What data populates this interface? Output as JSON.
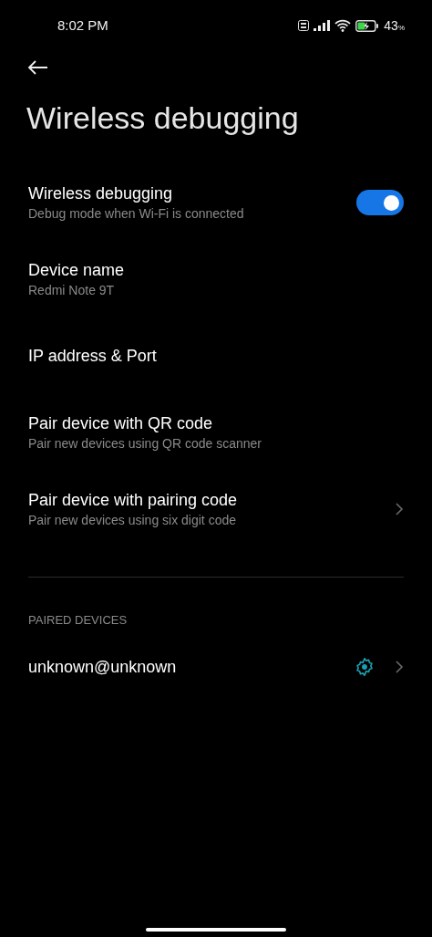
{
  "status_bar": {
    "time": "8:02 PM",
    "battery_text": "43",
    "battery_unit": "%",
    "charging": true
  },
  "title": "Wireless debugging",
  "settings": [
    {
      "kind": "toggle",
      "title": "Wireless debugging",
      "subtitle": "Debug mode when Wi-Fi is connected",
      "on": true
    },
    {
      "kind": "text",
      "title": "Device name",
      "subtitle": "Redmi Note 9T"
    },
    {
      "kind": "text",
      "title": "IP address & Port"
    },
    {
      "kind": "text",
      "title": "Pair device with QR code",
      "subtitle": "Pair new devices using QR code scanner"
    },
    {
      "kind": "chevron",
      "title": "Pair device with pairing code",
      "subtitle": "Pair new devices using six digit code"
    }
  ],
  "paired_section": {
    "header": "PAIRED DEVICES",
    "devices": [
      {
        "name": "unknown@unknown"
      }
    ]
  }
}
